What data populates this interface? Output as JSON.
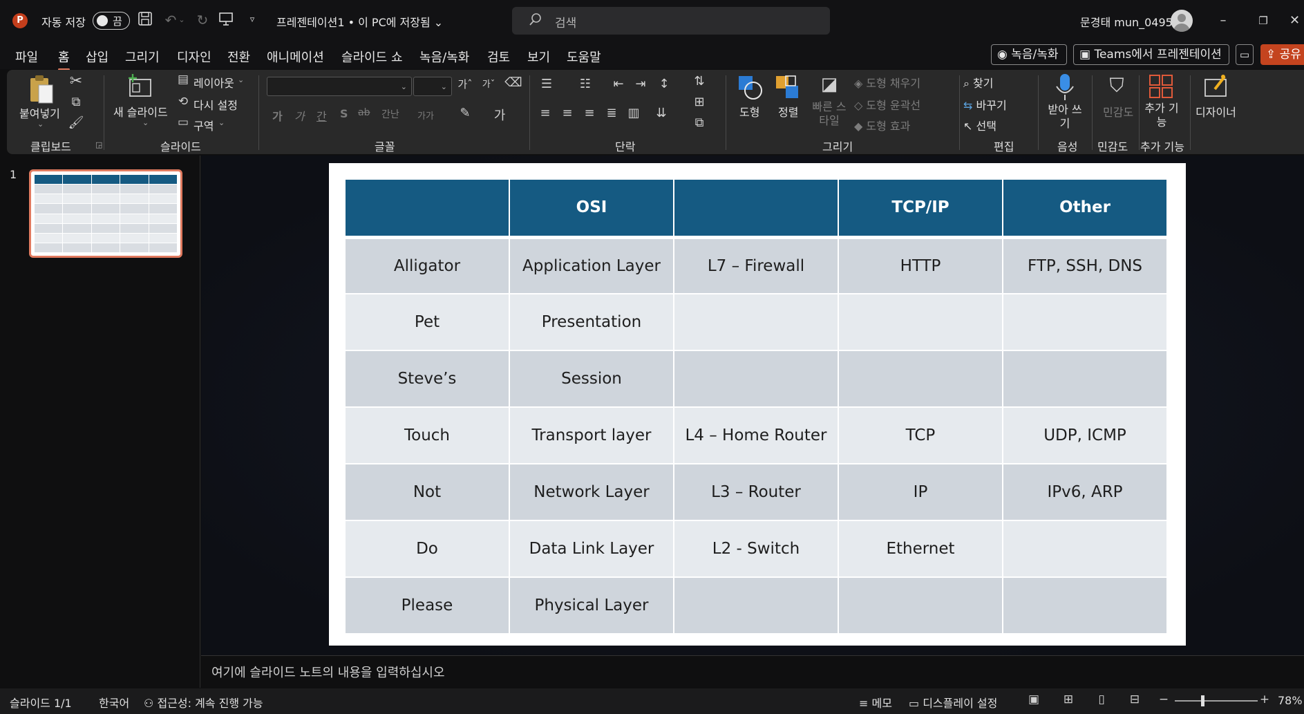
{
  "titlebar": {
    "app_logo": "P",
    "autosave_label": "자동 저장",
    "autosave_state": "끔",
    "doc_title": "프레젠테이션1 • 이 PC에 저장됨 ⌄",
    "search_placeholder": "검색",
    "user_name": "문경태 mun_0495",
    "icons": [
      "save-icon",
      "undo-icon",
      "redo-icon",
      "present-icon",
      "customize-icon"
    ]
  },
  "menu": {
    "tabs": [
      "파일",
      "홈",
      "삽입",
      "그리기",
      "디자인",
      "전환",
      "애니메이션",
      "슬라이드 쇼",
      "녹음/녹화",
      "검토",
      "보기",
      "도움말"
    ],
    "active": "홈",
    "record_button": "◉ 녹음/녹화",
    "teams_button": "Teams에서 프레젠테이션",
    "share_button": "공유"
  },
  "ribbon": {
    "clipboard": {
      "label": "클립보드",
      "paste": "붙여넣기"
    },
    "slides": {
      "label": "슬라이드",
      "new_slide": "새 슬라이드",
      "layout": "레이아웃",
      "reset": "다시 설정",
      "section": "구역"
    },
    "font": {
      "label": "글꼴",
      "bold": "가",
      "italic": "가",
      "underline": "간",
      "shadow": "S",
      "strike": "ab",
      "spacing": "간난",
      "case": "가가"
    },
    "paragraph": {
      "label": "단락"
    },
    "drawing": {
      "label": "그리기",
      "shapes": "도형",
      "arrange": "정렬",
      "quick_styles": "빠른 스타일",
      "shape_fill": "도형 채우기",
      "shape_outline": "도형 윤곽선",
      "shape_effects": "도형 효과"
    },
    "editing": {
      "label": "편집",
      "find": "찾기",
      "replace": "바꾸기",
      "select": "선택"
    },
    "voice": {
      "label": "음성",
      "dictate": "받아 쓰기"
    },
    "sensitivity": {
      "label": "민감도",
      "button": "민감도"
    },
    "addins": {
      "label": "추가 기능",
      "button": "추가 기능"
    },
    "designer": {
      "button": "디자이너"
    }
  },
  "thumbnails": {
    "slide_number": "1"
  },
  "slide": {
    "headers": [
      "",
      "OSI",
      "",
      "TCP/IP",
      "Other"
    ],
    "rows": [
      [
        "Alligator",
        "Application Layer",
        "L7 – Firewall",
        "HTTP",
        "FTP, SSH, DNS"
      ],
      [
        "Pet",
        "Presentation",
        "",
        "",
        ""
      ],
      [
        "Steve’s",
        "Session",
        "",
        "",
        ""
      ],
      [
        "Touch",
        "Transport layer",
        "L4 – Home Router",
        "TCP",
        "UDP, ICMP"
      ],
      [
        "Not",
        "Network Layer",
        "L3 – Router",
        "IP",
        "IPv6, ARP"
      ],
      [
        "Do",
        "Data Link Layer",
        "L2 - Switch",
        "Ethernet",
        ""
      ],
      [
        "Please",
        "Physical Layer",
        "",
        "",
        ""
      ]
    ],
    "colors": {
      "header": "#155a82",
      "row_dark": "#cfd5dc",
      "row_light": "#e6eaee"
    }
  },
  "notes": {
    "placeholder": "여기에 슬라이드 노트의 내용을 입력하십시오"
  },
  "statusbar": {
    "slide_counter": "슬라이드 1/1",
    "language": "한국어",
    "accessibility": "접근성: 계속 진행 가능",
    "notes": "메모",
    "display_settings": "디스플레이 설정",
    "zoom": "78%"
  }
}
